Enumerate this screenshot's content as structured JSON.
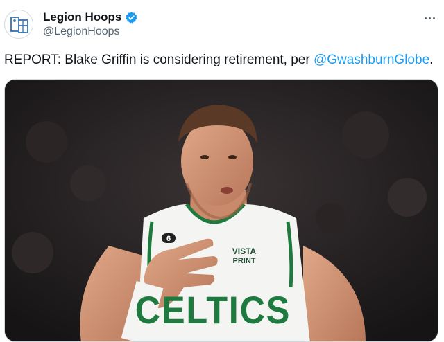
{
  "account": {
    "display_name": "Legion Hoops",
    "handle": "@LegionHoops",
    "avatar_icon": "legion-hoops-logo",
    "verified_icon": "verified-badge-icon",
    "verified_color": "#1d9bf0"
  },
  "menu": {
    "icon": "more-options-icon"
  },
  "tweet": {
    "text_before": "REPORT: Blake Griffin is considering retirement, per ",
    "mention": "@GwashburnGlobe",
    "text_after": ".",
    "mention_color": "#1d9bf0"
  },
  "media": {
    "jersey_sponsor": "VISTA",
    "jersey_sponsor_line2": "PRINT",
    "jersey_team": "CELTICS",
    "jersey_patch_number": "6"
  }
}
